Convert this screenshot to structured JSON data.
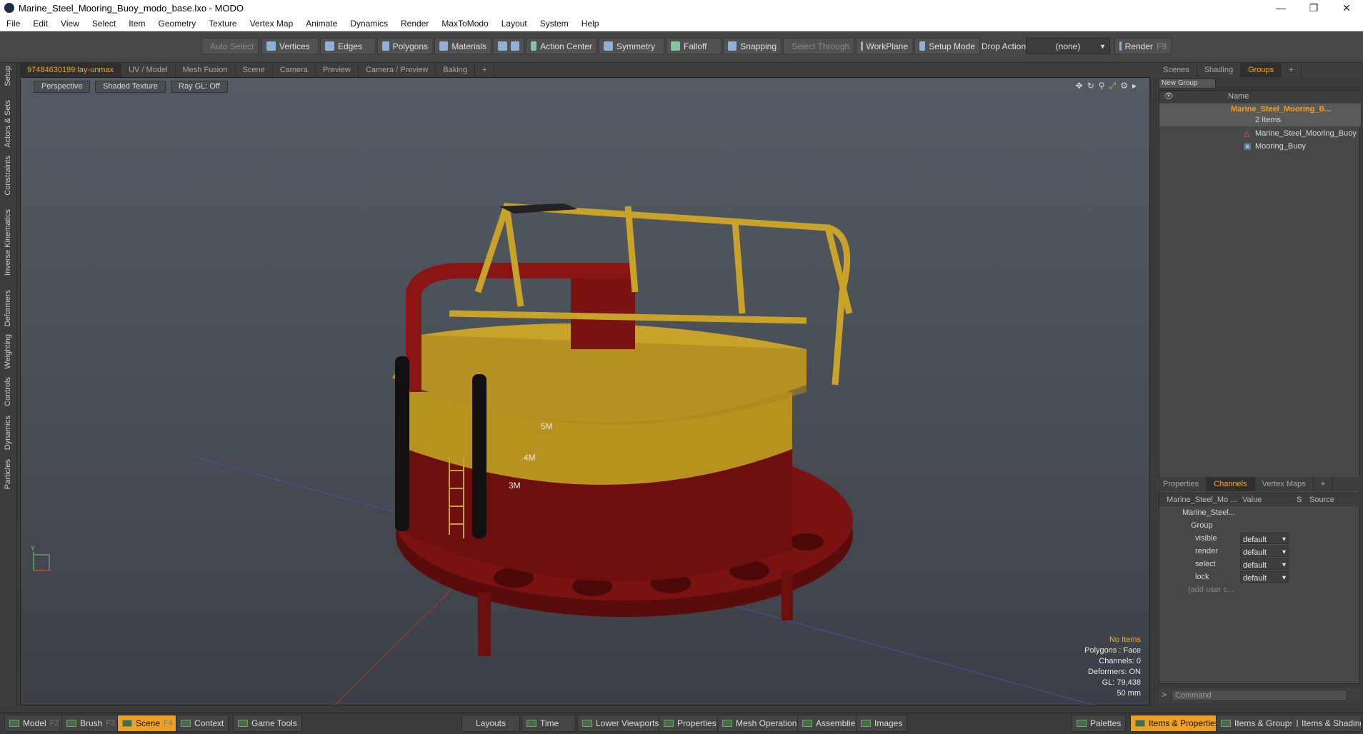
{
  "window": {
    "title": "Marine_Steel_Mooring_Buoy_modo_base.lxo - MODO"
  },
  "menu": [
    "File",
    "Edit",
    "View",
    "Select",
    "Item",
    "Geometry",
    "Texture",
    "Vertex Map",
    "Animate",
    "Dynamics",
    "Render",
    "MaxToModo",
    "Layout",
    "System",
    "Help"
  ],
  "toolbar": {
    "auto_select": "Auto Select",
    "vertices": "Vertices",
    "edges": "Edges",
    "polygons": "Polygons",
    "materials": "Materials",
    "action_center": "Action Center",
    "symmetry": "Symmetry",
    "falloff": "Falloff",
    "snapping": "Snapping",
    "select_through": "Select Through",
    "workplane": "WorkPlane",
    "setup_mode": "Setup Mode",
    "drop_action": "Drop Action",
    "drop_value": "(none)",
    "render": "Render",
    "render_key": "F9"
  },
  "left_tabs": [
    "Setup",
    "Actors & Sets",
    "Constraints",
    "Inverse Kinematics",
    "Deformers",
    "Weighting",
    "Controls",
    "Dynamics",
    "Particles"
  ],
  "viewport_tabs": [
    "97484630199:lay-unmax",
    "UV / Model",
    "Mesh Fusion",
    "Scene",
    "Camera",
    "Preview",
    "Camera / Preview",
    "Baking",
    "+"
  ],
  "viewport": {
    "perspective": "Perspective",
    "shading": "Shaded Texture",
    "raygl": "Ray GL: Off",
    "info": {
      "items": "No Items",
      "polygons": "Polygons : Face",
      "channels": "Channels: 0",
      "deformers": "Deformers: ON",
      "gl": "GL: 79,438",
      "focal": "50 mm"
    },
    "markings": {
      "m5": "5M",
      "m4": "4M",
      "m3": "3M"
    },
    "axis_y": "Y"
  },
  "groups_panel": {
    "tabs": [
      "Scenes",
      "Shading",
      "Groups",
      "+"
    ],
    "new_group": "New Group",
    "name_header": "Name",
    "group_name": "Marine_Steel_Mooring_B...",
    "group_count": "2 Items",
    "children": [
      "Marine_Steel_Mooring_Buoy",
      "Mooring_Buoy"
    ]
  },
  "channels_panel": {
    "tabs": [
      "Properties",
      "Channels",
      "Vertex Maps",
      "+"
    ],
    "headers": {
      "name": "Marine_Steel_Mo ...",
      "value": "Value",
      "s": "S",
      "source": "Source"
    },
    "root": "Marine_Steel...",
    "group": "Group",
    "rows": [
      {
        "name": "visible",
        "value": "default"
      },
      {
        "name": "render",
        "value": "default"
      },
      {
        "name": "select",
        "value": "default"
      },
      {
        "name": "lock",
        "value": "default"
      }
    ],
    "add_user": "(add user c..."
  },
  "command": {
    "placeholder": "Command"
  },
  "statusbar": {
    "model": "Model",
    "model_key": "F2",
    "brush": "Brush",
    "brush_key": "F3",
    "scene": "Scene",
    "scene_key": "F4",
    "context": "Context",
    "game_tools": "Game Tools",
    "layouts": "Layouts",
    "time": "Time",
    "lower_viewports": "Lower Viewports",
    "properties": "Properties",
    "mesh_operations": "Mesh Operations",
    "assemblies": "Assemblies",
    "images": "Images",
    "palettes": "Palettes",
    "items_properties": "Items & Properties",
    "items_groups": "Items & Groups",
    "items_shading": "Items & Shading"
  },
  "colors": {
    "accent": "#f0a020",
    "buoy_yellow": "#c9a22a",
    "buoy_red": "#6e0f0f"
  }
}
